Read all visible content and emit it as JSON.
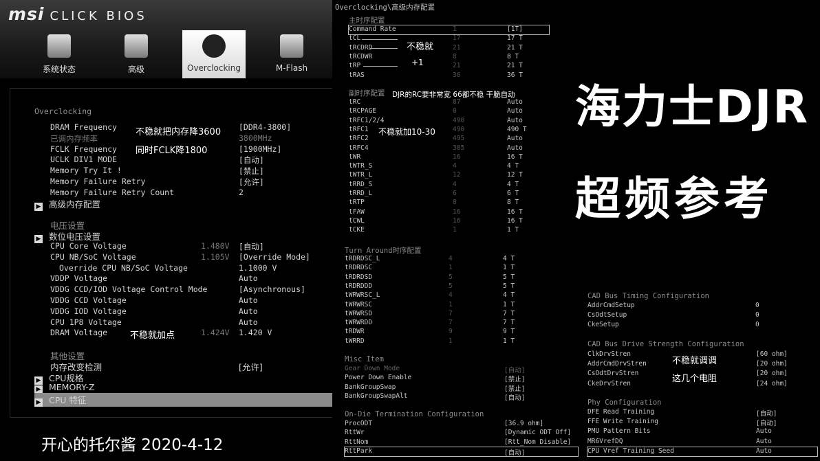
{
  "brand": {
    "logo": "msi",
    "product": "CLICK BIOS"
  },
  "tabs": [
    {
      "label": "系统状态"
    },
    {
      "label": "高级"
    },
    {
      "label": "Overclocking"
    },
    {
      "label": "M-Flash"
    }
  ],
  "left": {
    "heading": "Overclocking",
    "rows": [
      {
        "key": "DRAM Frequency",
        "value": "[DDR4-3800]"
      },
      {
        "key": "已调内存频率",
        "value": "3800MHz"
      },
      {
        "key": "FCLK Frequency",
        "value": "[1900MHz]"
      },
      {
        "key": "UCLK DIV1 MODE",
        "value": "[自动]"
      },
      {
        "key": "Memory Try It !",
        "value": "[禁止]"
      },
      {
        "key": "Memory Failure Retry",
        "value": "[允许]"
      },
      {
        "key": "Memory Failure Retry Count",
        "value": "2"
      }
    ],
    "sub_advanced_mem": "高级内存配置",
    "voltage_heading": "电压设置",
    "sub_digital_voltage": "数位电压设置",
    "vrows": [
      {
        "key": "CPU Core Voltage",
        "meas": "1.480V",
        "value": "[自动]"
      },
      {
        "key": "CPU NB/SoC Voltage",
        "meas": "1.105V",
        "value": "[Override Mode]"
      },
      {
        "key": "Override CPU NB/SoC Voltage",
        "meas": "",
        "value": "1.1000 V"
      },
      {
        "key": "VDDP Voltage",
        "meas": "",
        "value": "Auto"
      },
      {
        "key": "VDDG CCD/IOD Voltage Control Mode",
        "meas": "",
        "value": "[Asynchronous]"
      },
      {
        "key": "VDDG CCD Voltage",
        "meas": "",
        "value": "Auto"
      },
      {
        "key": "VDDG IOD Voltage",
        "meas": "",
        "value": "Auto"
      },
      {
        "key": "CPU 1P8 Voltage",
        "meas": "",
        "value": "Auto"
      },
      {
        "key": "DRAM Voltage",
        "meas": "1.424V",
        "value": "1.420 V"
      }
    ],
    "other_heading": "其他设置",
    "mem_change_detect": {
      "key": "内存改变检测",
      "value": "[允许]"
    },
    "subs": [
      "CPU规格",
      "MEMORY-Z",
      "CPU 特征"
    ],
    "annotations": {
      "a1": "不稳就把内存降3600",
      "a2": "同时FCLK降1800",
      "a3": "不稳就加点"
    }
  },
  "mid": {
    "path": "Overclocking\\高级内存配置",
    "primary_heading": "主时序配置",
    "primary": [
      {
        "k": "Command Rate",
        "m": "1",
        "v": "[1T]"
      },
      {
        "k": "tCL",
        "m": "17",
        "v": "17 T"
      },
      {
        "k": "tRCDRD",
        "m": "21",
        "v": "21 T"
      },
      {
        "k": "tRCDWR",
        "m": "8",
        "v": "8 T"
      },
      {
        "k": "tRP",
        "m": "21",
        "v": "21 T"
      },
      {
        "k": "tRAS",
        "m": "36",
        "v": "36 T"
      }
    ],
    "secondary_heading": "副时序配置",
    "secondary": [
      {
        "k": "tRC",
        "m": "87",
        "v": "Auto"
      },
      {
        "k": "tRCPAGE",
        "m": "0",
        "v": "Auto"
      },
      {
        "k": "tRFC1/2/4",
        "m": "490",
        "v": "Auto"
      },
      {
        "k": "tRFC1",
        "m": "490",
        "v": "490 T"
      },
      {
        "k": "tRFC2",
        "m": "495",
        "v": "Auto"
      },
      {
        "k": "tRFC4",
        "m": "305",
        "v": "Auto"
      },
      {
        "k": "tWR",
        "m": "16",
        "v": "16 T"
      },
      {
        "k": "tWTR_S",
        "m": "4",
        "v": "4 T"
      },
      {
        "k": "tWTR_L",
        "m": "12",
        "v": "12 T"
      },
      {
        "k": "tRRD_S",
        "m": "4",
        "v": "4 T"
      },
      {
        "k": "tRRD_L",
        "m": "6",
        "v": "6 T"
      },
      {
        "k": "tRTP",
        "m": "8",
        "v": "8 T"
      },
      {
        "k": "tFAW",
        "m": "16",
        "v": "16 T"
      },
      {
        "k": "tCWL",
        "m": "16",
        "v": "16 T"
      },
      {
        "k": "tCKE",
        "m": "1",
        "v": "1 T"
      }
    ],
    "turnaround_heading": "Turn Around时序配置",
    "turnaround": [
      {
        "k": "tRDRDSC_L",
        "m": "4",
        "v": "4 T"
      },
      {
        "k": "tRDRDSC",
        "m": "1",
        "v": "1 T"
      },
      {
        "k": "tRDRDSD",
        "m": "5",
        "v": "5 T"
      },
      {
        "k": "tRDRDDD",
        "m": "5",
        "v": "5 T"
      },
      {
        "k": "tWRWRSC_L",
        "m": "4",
        "v": "4 T"
      },
      {
        "k": "tWRWRSC",
        "m": "1",
        "v": "1 T"
      },
      {
        "k": "tWRWRSD",
        "m": "7",
        "v": "7 T"
      },
      {
        "k": "tWRWRDD",
        "m": "7",
        "v": "7 T"
      },
      {
        "k": "tRDWR",
        "m": "9",
        "v": "9 T"
      },
      {
        "k": "tWRRD",
        "m": "1",
        "v": "1 T"
      }
    ],
    "misc_heading": "Misc Item",
    "misc": [
      {
        "k": "Gear Down Mode",
        "v": "[自动]",
        "dim": true
      },
      {
        "k": "Power Down Enable",
        "v": "[禁止]",
        "dim": false
      },
      {
        "k": "BankGroupSwap",
        "v": "[禁止]",
        "dim": false
      },
      {
        "k": "BankGroupSwapAlt",
        "v": "[自动]",
        "dim": false
      }
    ],
    "odt_heading": "On-Die Termination Configuration",
    "odt": [
      {
        "k": "ProcODT",
        "v": "[36.9 ohm]"
      },
      {
        "k": "RttWr",
        "v": "[Dynamic ODT Off]"
      },
      {
        "k": "RttNom",
        "v": "[Rtt_Nom Disable]"
      },
      {
        "k": "RttPark",
        "v": "[自动]"
      }
    ],
    "annotations": {
      "unstable": "不稳就",
      "plus1": "+1",
      "rc_note": "DJR的RC要非常宽 66都不稳 干脆自动",
      "rfc_note": "不稳就加10-30"
    }
  },
  "right": {
    "title_line1": "海力士DJR",
    "title_line2": "超频参考",
    "cad_timing_heading": "CAD Bus Timing Configuration",
    "cad_timing": [
      {
        "k": "AddrCmdSetup",
        "v": "0"
      },
      {
        "k": "CsOdtSetup",
        "v": "0"
      },
      {
        "k": "CkeSetup",
        "v": "0"
      }
    ],
    "cad_drive_heading": "CAD Bus Drive Strength Configuration",
    "cad_drive": [
      {
        "k": "ClkDrvStren",
        "v": "[60 ohm]"
      },
      {
        "k": "AddrCmdDrvStren",
        "v": "[20 ohm]"
      },
      {
        "k": "CsOdtDrvStren",
        "v": "[20 ohm]"
      },
      {
        "k": "CkeDrvStren",
        "v": "[24 ohm]"
      }
    ],
    "phy_heading": "Phy Configuration",
    "phy": [
      {
        "k": "DFE Read Training",
        "v": "[自动]"
      },
      {
        "k": "FFE Write Training",
        "v": "[自动]"
      },
      {
        "k": "PMU Pattern Bits",
        "v": "Auto"
      },
      {
        "k": "MR6VrefDQ",
        "v": "Auto"
      },
      {
        "k": "CPU Vref Training Seed",
        "v": "Auto"
      }
    ],
    "annotations": {
      "a1": "不稳就调调",
      "a2": "这几个电阻"
    }
  },
  "footer": {
    "author": "开心的托尔酱 2020-4-12"
  },
  "colors": {
    "selected_bar": "#8a8a8a",
    "text": "#d4d4d4",
    "dim": "#777777"
  }
}
